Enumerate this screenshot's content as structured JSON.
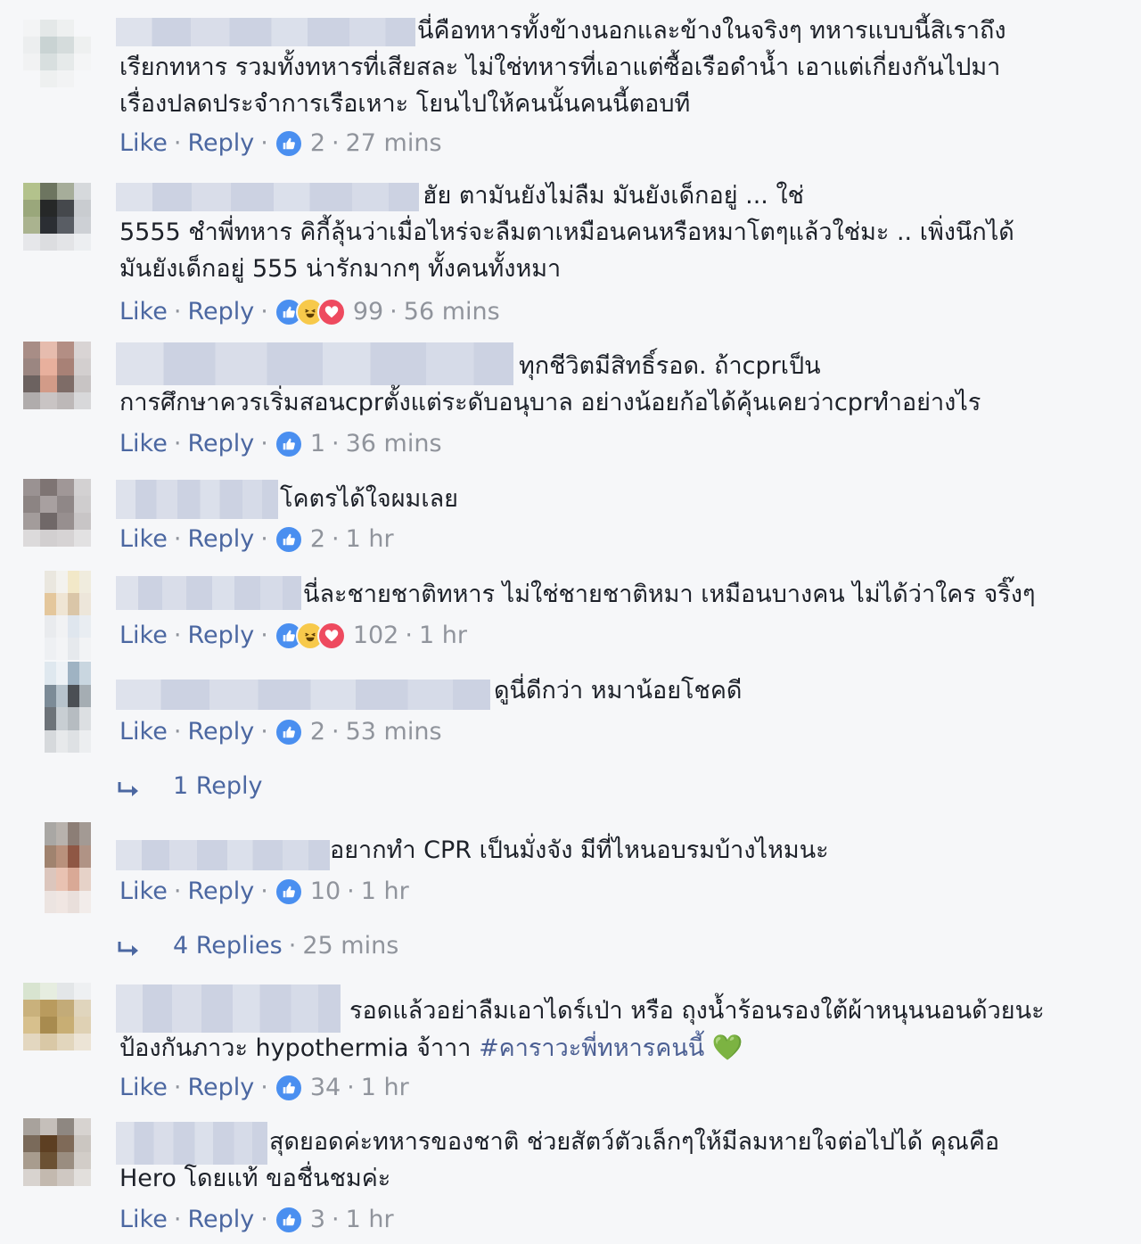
{
  "colors": {
    "background": "#f6f7f9",
    "link": "#4b67a1",
    "meta": "#90949c",
    "like": "#4a8ff0",
    "haha": "#f7c94b",
    "love": "#ee4a5f"
  },
  "actions": {
    "like": "Like",
    "reply": "Reply",
    "dot": "·"
  },
  "comments": [
    {
      "text": [
        "นี่คือทหารทั้งข้างนอกและข้างในจริงๆ ทหารแบบนี้สิเราถึง",
        "เรียกทหาร รวมทั้งทหารที่เสียสละ ไม่ใช่ทหารที่เอาแต่ซื้อเรือดำน้ำ เอาแต่เกี่ยงกันไปมา",
        "เรื่องปลดประจำการเรือเหาะ โยนไปให้คนนั้นคนนี้ตอบที"
      ],
      "reactions": [
        "like"
      ],
      "count": "2",
      "time": "27 mins"
    },
    {
      "text": [
        "ฮัย ตามันยังไม่ลืม มันยังเด็กอยู่ ... ใช่",
        "5555 ชำพี่ทหาร คิกี้ลุ้นว่าเมื่อไหร่จะลืมตาเหมือนคนหรือหมาโตๆแล้วใช่มะ .. เพิ่งนึกได้",
        "มันยังเด็กอยู่ 555 น่ารักมากๆ ทั้งคนทั้งหมา"
      ],
      "reactions": [
        "like",
        "haha",
        "love"
      ],
      "count": "99",
      "time": "56 mins"
    },
    {
      "text": [
        "ทุกชีวิตมีสิทธิ์รอด. ถ้าcprเป็น",
        "การศึกษาควรเริ่มสอนcprตั้งแต่ระดับอนุบาล อย่างน้อยก้อได้คุ้นเคยว่าcprทำอย่างไร"
      ],
      "reactions": [
        "like"
      ],
      "count": "1",
      "time": "36 mins"
    },
    {
      "text": [
        "โคตรได้ใจผมเลย"
      ],
      "reactions": [
        "like"
      ],
      "count": "2",
      "time": "1 hr"
    },
    {
      "text": [
        "นี่ละชายชาติทหาร ไม่ใช่ชายชาติหมา เหมือนบางคน ไม่ได้ว่าใคร จริ๊งๆ"
      ],
      "reactions": [
        "like",
        "haha",
        "love"
      ],
      "count": "102",
      "time": "1 hr"
    },
    {
      "text": [
        "ดูนี่ดีกว่า หมาน้อยโชคดี"
      ],
      "reactions": [
        "like"
      ],
      "count": "2",
      "time": "53 mins",
      "replies": {
        "label": "1 Reply",
        "time": ""
      }
    },
    {
      "text": [
        "อยากทำ CPR เป็นมั่งจัง มีที่ไหนอบรมบ้างไหมนะ"
      ],
      "reactions": [
        "like"
      ],
      "count": "10",
      "time": "1 hr",
      "replies": {
        "label": "4 Replies",
        "time": "25 mins"
      }
    },
    {
      "text": [
        "รอดแล้วอย่าลืมเอาไดร์เป่า หรือ ถุงน้ำร้อนรองใต้ผ้าหนุนนอนด้วยนะ",
        "ป้องกันภาวะ hypothermia จ้าาา"
      ],
      "hashtag": "#คาราวะพี่ทหารคนนี้",
      "emoji": "💚",
      "reactions": [
        "like"
      ],
      "count": "34",
      "time": "1 hr"
    },
    {
      "text": [
        "สุดยอดค่ะทหารของชาติ ช่วยสัตว์ตัวเล็กๆให้มีลมหายใจต่อไปได้ คุณคือ",
        "Hero โดยแท้ ขอชื่นชมค่ะ"
      ],
      "reactions": [
        "like"
      ],
      "count": "3",
      "time": "1 hr"
    }
  ]
}
